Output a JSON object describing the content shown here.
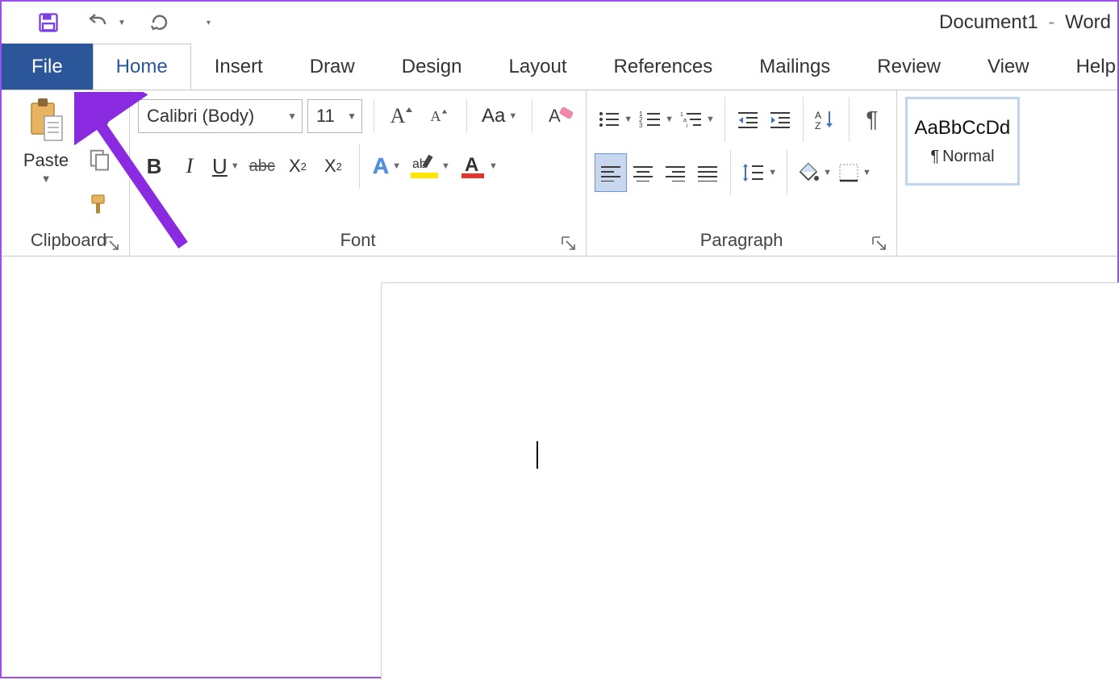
{
  "title": {
    "doc": "Document1",
    "sep": "-",
    "app": "Word"
  },
  "qat": {
    "customize": "▾"
  },
  "tabs": [
    "File",
    "Home",
    "Insert",
    "Draw",
    "Design",
    "Layout",
    "References",
    "Mailings",
    "Review",
    "View",
    "Help"
  ],
  "active_tab": 1,
  "ribbon": {
    "clipboard": {
      "paste": "Paste",
      "label": "Clipboard"
    },
    "font": {
      "label": "Font",
      "name": "Calibri (Body)",
      "size": "11",
      "grow": "A",
      "shrink": "A",
      "case": "Aa",
      "bold": "B",
      "italic": "I",
      "underline": "U",
      "strike": "abc",
      "subscript": "X",
      "sub_sub": "2",
      "superscript": "X",
      "sup_sup": "2",
      "texteffects": "A",
      "highlight": "ab",
      "fontcolor": "A",
      "clear": "A"
    },
    "paragraph": {
      "label": "Paragraph",
      "sort": "A",
      "sort2": "Z",
      "pilcrow": "¶",
      "numlist_digits": [
        "1",
        "2",
        "3"
      ]
    },
    "styles": {
      "preview": "AaBbCcDd",
      "name": "Normal",
      "pilcrow": "¶"
    }
  },
  "annotation": {
    "arrow_color": "#8a2be2"
  }
}
